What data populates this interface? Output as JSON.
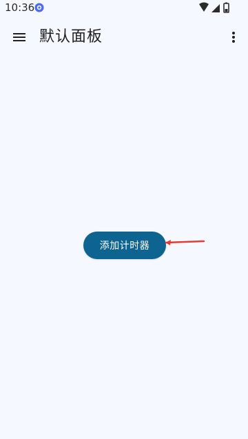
{
  "status_bar": {
    "time": "10:36"
  },
  "app_bar": {
    "title": "默认面板"
  },
  "main": {
    "add_timer_label": "添加计时器"
  },
  "icons": {
    "menu": "hamburger-menu-icon",
    "overflow": "more-vert-icon",
    "notification": "app-notification-icon",
    "wifi": "wifi-icon",
    "signal": "signal-icon",
    "battery": "battery-icon"
  },
  "colors": {
    "background": "#f5f9ff",
    "primary_button": "#0e6491",
    "annotation_arrow": "#e53935"
  }
}
